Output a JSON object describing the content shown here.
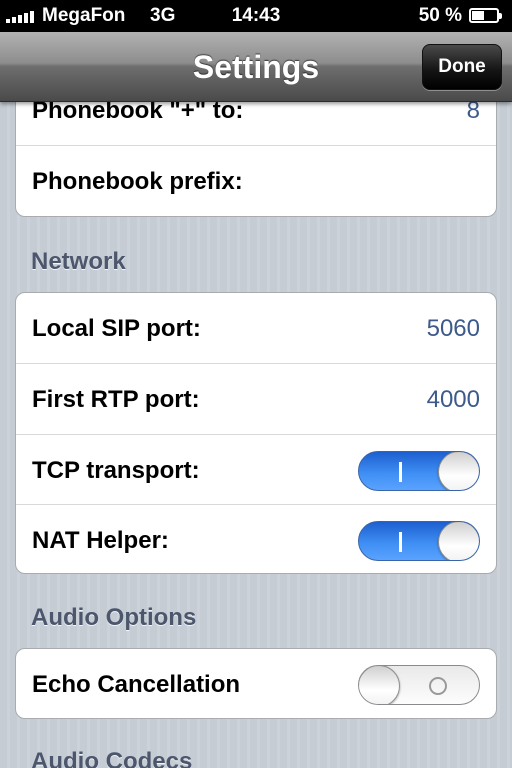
{
  "status_bar": {
    "carrier": "MegaFon",
    "network": "3G",
    "time": "14:43",
    "battery": "50 %",
    "battery_level": 0.5,
    "signal_bars": 5
  },
  "nav": {
    "title": "Settings",
    "done_label": "Done"
  },
  "sections": {
    "phonebook": {
      "rows": [
        {
          "label": "Phonebook \"+\" to:",
          "value": "8"
        },
        {
          "label": "Phonebook prefix:",
          "value": ""
        }
      ]
    },
    "network": {
      "header": "Network",
      "local_sip_port": {
        "label": "Local SIP port:",
        "value": "5060"
      },
      "first_rtp_port": {
        "label": "First RTP port:",
        "value": "4000"
      },
      "tcp_transport": {
        "label": "TCP transport:",
        "on": true
      },
      "nat_helper": {
        "label": "NAT Helper:",
        "on": true
      }
    },
    "audio_options": {
      "header": "Audio Options",
      "echo_cancellation": {
        "label": "Echo Cancellation",
        "on": false
      }
    },
    "audio_codecs": {
      "header": "Audio Codecs"
    }
  }
}
